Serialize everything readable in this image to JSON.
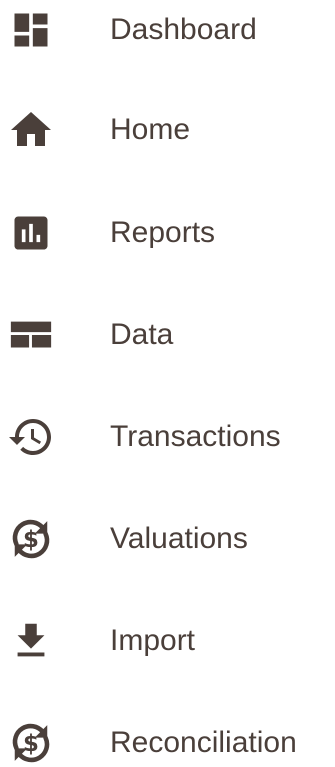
{
  "icon_color": "#4a3f3a",
  "text_color": "#4a3f3a",
  "nav": {
    "items": [
      {
        "label": "Dashboard",
        "icon": "dashboard-icon"
      },
      {
        "label": "Home",
        "icon": "home-icon"
      },
      {
        "label": "Reports",
        "icon": "bar-chart-icon"
      },
      {
        "label": "Data",
        "icon": "table-icon"
      },
      {
        "label": "Transactions",
        "icon": "history-icon"
      },
      {
        "label": "Valuations",
        "icon": "currency-exchange-icon"
      },
      {
        "label": "Import",
        "icon": "download-icon"
      },
      {
        "label": "Reconciliation",
        "icon": "currency-exchange-icon"
      }
    ]
  }
}
